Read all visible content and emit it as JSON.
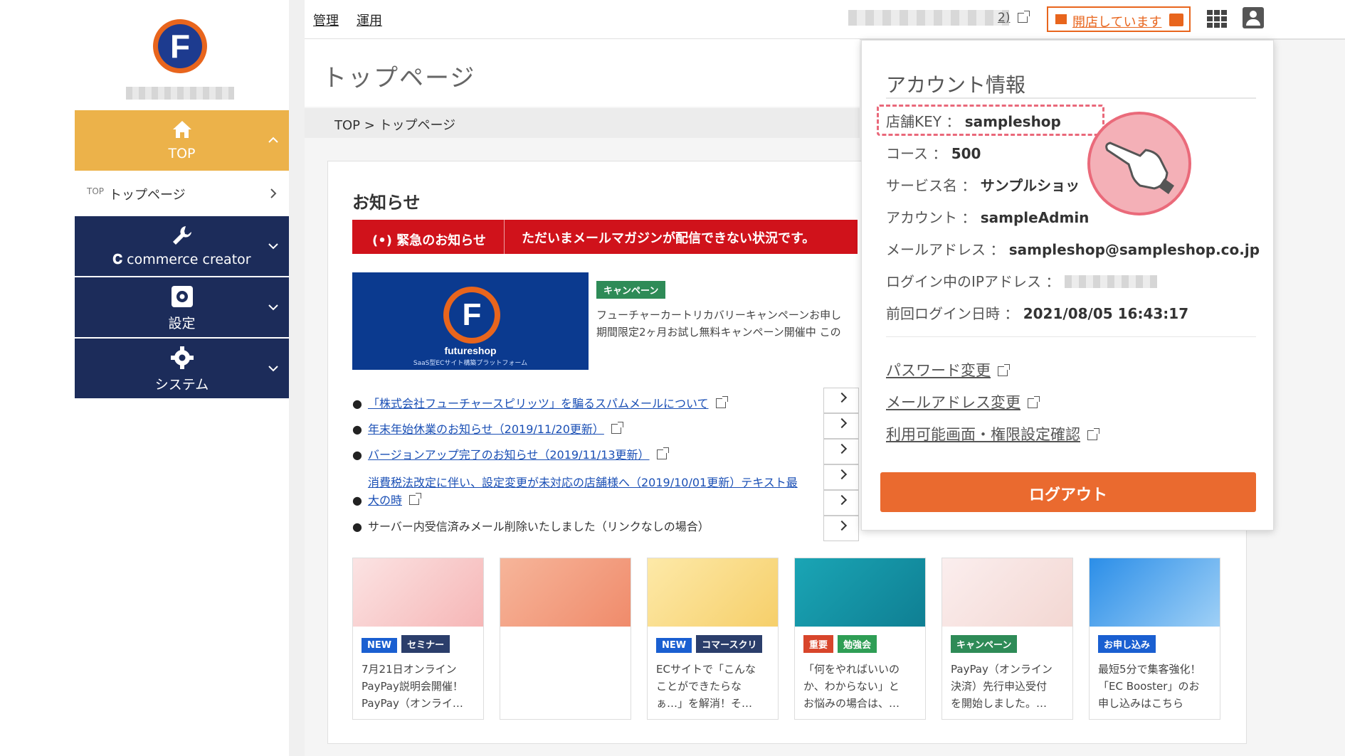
{
  "sidebar": {
    "top_label": "TOP",
    "sub_item_tag": "TOP",
    "sub_item_label": "トップページ",
    "commerce_label": "commerce creator",
    "settings_label": "設定",
    "system_label": "システム"
  },
  "topbar": {
    "menu": [
      "管理",
      "運用"
    ],
    "user_suffix": "2)",
    "open_status": "開店しています"
  },
  "page": {
    "title": "トップページ",
    "breadcrumb": "TOP > トップページ"
  },
  "notice": {
    "title": "お知らせ",
    "urgent_tag": "緊急のお知らせ",
    "urgent_message": "ただいまメールマガジンが配信できない状況です。",
    "banner_brand": "futureshop",
    "banner_sub": "SaaS型ECサイト構築プラットフォーム",
    "campaign_tag": "キャンペーン",
    "campaign_line1": "フューチャーカートリカバリーキャンペーンお申し",
    "campaign_line2": "期間限定2ヶ月お試し無料キャンペーン開催中 この",
    "news": [
      "「株式会社フューチャースピリッツ」を騙るスパムメールについて",
      "年末年始休業のお知らせ（2019/11/20更新）",
      "バージョンアップ完了のお知らせ（2019/11/13更新）",
      "消費税法改定に伴い、設定変更が未対応の店舗様へ（2019/10/01更新）テキスト最",
      "大の時",
      "サーバー内受信済みメール削除いたしました（リンクなしの場合）"
    ]
  },
  "tiles": [
    {
      "tags": [
        "NEW",
        "セミナー"
      ],
      "lines": [
        "7月21日オンライン",
        "PayPay説明会開催！",
        "PayPay（オンライ…"
      ]
    },
    {
      "tags": [],
      "lines": []
    },
    {
      "tags": [
        "NEW",
        "コマースクリ"
      ],
      "lines": [
        "ECサイトで「こんな",
        "ことができたらな",
        "ぁ…」を解消！そ…"
      ]
    },
    {
      "tags": [
        "重要",
        "勉強会"
      ],
      "lines": [
        "「何をやればいいの",
        "か、わからない」と",
        "お悩みの場合は、…"
      ]
    },
    {
      "tags": [
        "キャンペーン"
      ],
      "lines": [
        "PayPay（オンライン",
        "決済）先行申込受付",
        "を開始しました。…"
      ]
    },
    {
      "tags": [
        "お申し込み"
      ],
      "lines": [
        "最短5分で集客強化！",
        "「EC Booster」のお",
        "申し込みはこちら"
      ]
    }
  ],
  "account": {
    "title": "アカウント情報",
    "shop_key_label": "店舗KEY",
    "shop_key": "sampleshop",
    "course_label": "コース",
    "course": "500",
    "service_label": "サービス名",
    "service": "サンプルショッ",
    "account_label": "アカウント",
    "account": "sampleAdmin",
    "mail_label": "メールアドレス",
    "mail": "sampleshop@sampleshop.co.jp",
    "ip_label": "ログイン中のIPアドレス",
    "last_login_label": "前回ログイン日時",
    "last_login": "2021/08/05 16:43:17",
    "link_password": "パスワード変更",
    "link_mail": "メールアドレス変更",
    "link_permission": "利用可能画面・権限設定確認",
    "logout": "ログアウト"
  },
  "colors": {
    "sidebar_active": "#ecb24a",
    "sidebar_dark": "#1c2c5a",
    "urgent": "#d0121b",
    "accent_orange": "#ea6a2f",
    "brand_blue": "#0b3a8f"
  }
}
